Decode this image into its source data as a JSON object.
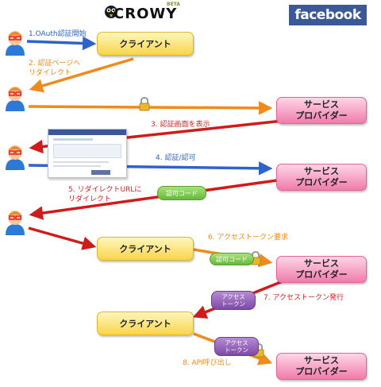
{
  "logos": {
    "crowy": "CROWY",
    "crowy_beta": "BETA",
    "facebook": "facebook"
  },
  "actors": {
    "client_label": "クライアント",
    "service_provider_label": "サービス\nプロバイダー"
  },
  "tokens": {
    "auth_code": "認可コード",
    "access_token": "アクセス\nトークン"
  },
  "steps": {
    "s1": "1.OAuth認証開始",
    "s2_line1": "2. 認証ページへ",
    "s2_line2": "リダイレクト",
    "s3": "3. 認証画面を表示",
    "s4": "4. 認証/認可",
    "s5_line1": "5. リダイレクトURLに",
    "s5_line2": "リダイレクト",
    "s6": "6. アクセストークン要求",
    "s7": "7. アクセストークン発行",
    "s8": "8. API呼び出し"
  },
  "colors": {
    "blue_arrow": "#2f63c9",
    "orange_arrow": "#f08a1c",
    "red_arrow": "#d11b1b",
    "client_fill": "#f8d54a",
    "provider_fill": "#f07cab",
    "auth_code_pill": "#67b93a",
    "access_token_pill": "#7d4aa5",
    "lock": "#e7b72c"
  },
  "icons": [
    "user-avatar-icon",
    "padlock-icon",
    "crow-logo-icon",
    "facebook-login-screenshot"
  ]
}
